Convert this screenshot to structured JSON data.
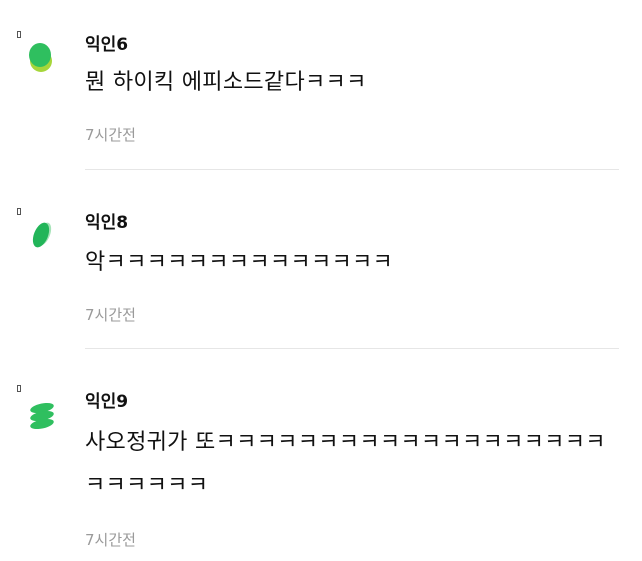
{
  "comments": [
    {
      "author": "익인6",
      "text": "뭔 하이킥 에피소드같다ㅋㅋㅋ",
      "time": "7시간전",
      "avatar_icon": "green-gem-icon",
      "avatar_color": "#2fbf5f"
    },
    {
      "author": "익인8",
      "text": "악ㅋㅋㅋㅋㅋㅋㅋㅋㅋㅋㅋㅋㅋㅋ",
      "time": "7시간전",
      "avatar_icon": "green-leaf-icon",
      "avatar_color": "#2fbf5f"
    },
    {
      "author": "익인9",
      "text": "사오정귀가 또ㅋㅋㅋㅋㅋㅋㅋㅋㅋㅋㅋㅋㅋㅋㅋㅋㅋㅋㅋㅋㅋㅋㅋㅋㅋ",
      "time": "7시간전",
      "avatar_icon": "green-stack-icon",
      "avatar_color": "#2fbf5f"
    }
  ]
}
